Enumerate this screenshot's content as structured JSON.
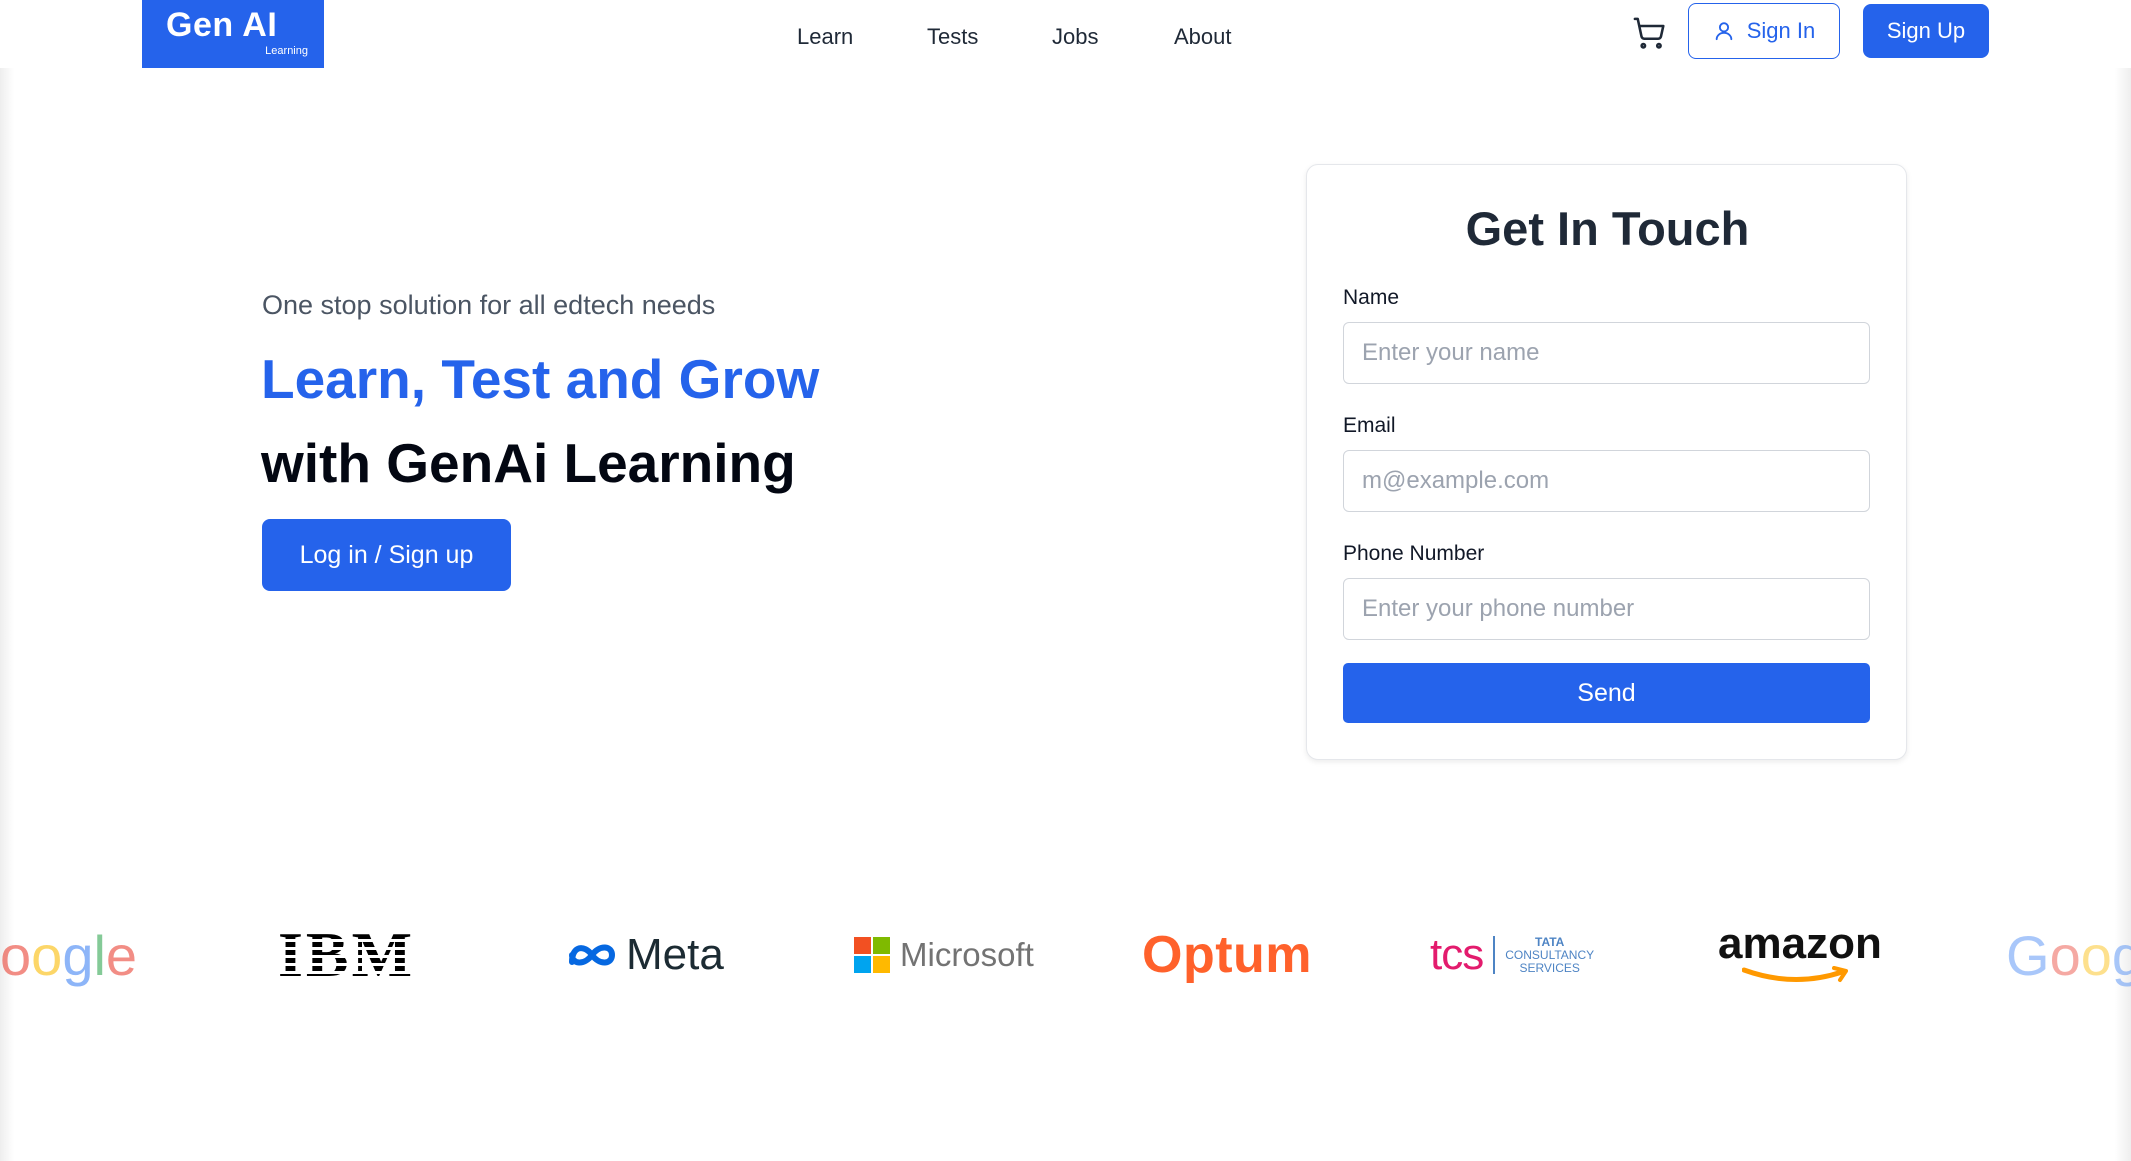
{
  "header": {
    "logo_main": "Gen AI",
    "logo_sub": "Learning",
    "nav": [
      "Learn",
      "Tests",
      "Jobs",
      "About"
    ],
    "cart_icon": "cart-icon",
    "signin_label": "Sign In",
    "signup_label": "Sign Up"
  },
  "hero": {
    "tagline": "One stop solution for all edtech needs",
    "headline_accent": "Learn, Test and Grow",
    "headline_main": "with GenAi Learning",
    "cta_label": "Log in / Sign up"
  },
  "contact": {
    "title": "Get In Touch",
    "name_label": "Name",
    "name_placeholder": "Enter your name",
    "email_label": "Email",
    "email_placeholder": "m@example.com",
    "phone_label": "Phone Number",
    "phone_placeholder": "Enter your phone number",
    "send_label": "Send"
  },
  "brands": {
    "google_left": "oogle",
    "ibm": "IBM",
    "meta": "Meta",
    "microsoft": "Microsoft",
    "optum": "Optum",
    "tcs": "tcs",
    "tcs_line1": "TATA",
    "tcs_line2": "CONSULTANCY",
    "tcs_line3": "SERVICES",
    "amazon": "amazon",
    "google_right": "Goog"
  },
  "colors": {
    "primary": "#2563eb",
    "google_blue": "#4285f4",
    "google_red": "#ea4335",
    "google_yellow": "#fbbc05",
    "google_green": "#34a853",
    "optum_orange": "#ff612b",
    "tcs_blue": "#4e84c4",
    "tcs_pink": "#e31b6d",
    "amazon_orange": "#ff9900"
  }
}
